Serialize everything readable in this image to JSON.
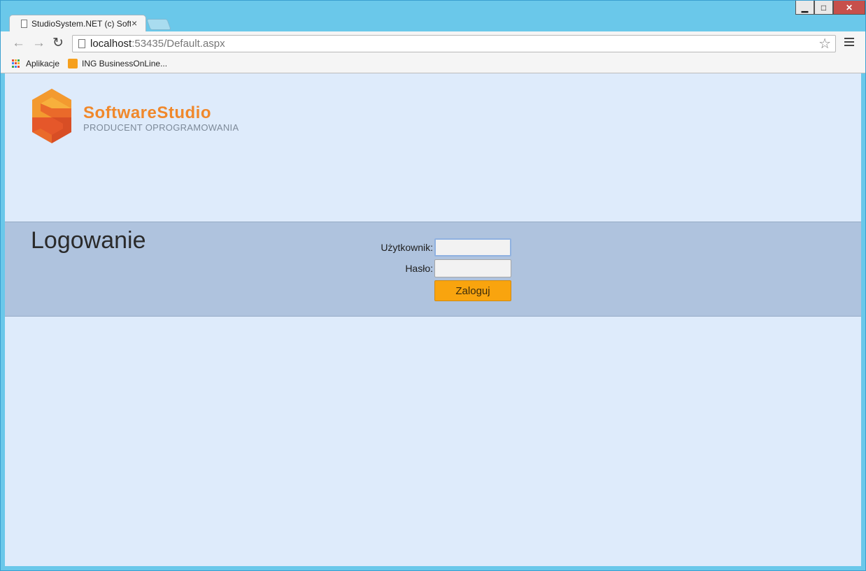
{
  "browser": {
    "tab_title": "StudioSystem.NET (c) Soft",
    "tab_close": "×",
    "url_host": "localhost",
    "url_rest": ":53435/Default.aspx",
    "window_controls": {
      "minimize": "▁",
      "maximize": "□",
      "close": "✕"
    },
    "nav": {
      "back": "←",
      "forward": "→",
      "reload": "↻",
      "star": "☆"
    },
    "bookmarks": [
      {
        "label": "Aplikacje",
        "icon": "apps-grid-icon"
      },
      {
        "label": "ING BusinessOnLine...",
        "icon": "ing-icon"
      }
    ],
    "colors": {
      "frame": "#6ac8ea",
      "close_button": "#c7504b"
    }
  },
  "page": {
    "logo": {
      "name_part1": "SoftwareStudio",
      "tagline": "PRODUCENT OPROGRAMOWANIA",
      "colors": {
        "orange": "#f0882b",
        "orange_dark": "#e5572a",
        "gray": "#7d8a99"
      }
    },
    "login": {
      "title": "Logowanie",
      "username_label": "Użytkownik:",
      "password_label": "Hasło:",
      "username_value": "",
      "password_value": "",
      "submit_label": "Zaloguj"
    },
    "colors": {
      "background": "#deebfb",
      "band": "#afc3de",
      "button": "#f9a40e"
    }
  }
}
